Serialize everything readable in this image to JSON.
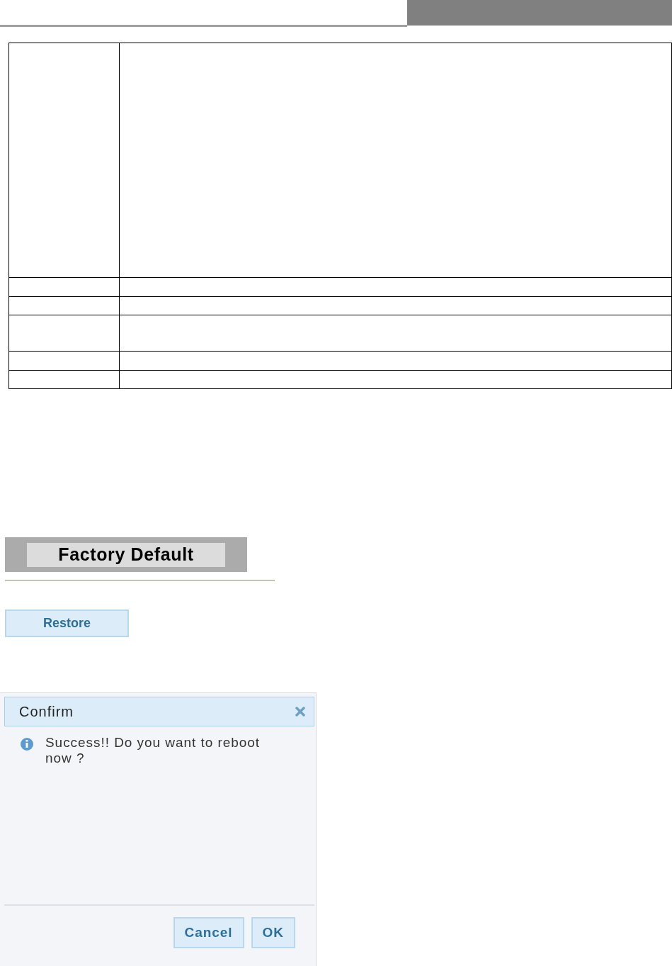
{
  "section_header": {
    "title": "Factory Default"
  },
  "restore_button": {
    "label": "Restore"
  },
  "dialog": {
    "title": "Confirm",
    "message": "Success!! Do you want to reboot now ?",
    "buttons": [
      "Cancel",
      "OK"
    ]
  }
}
